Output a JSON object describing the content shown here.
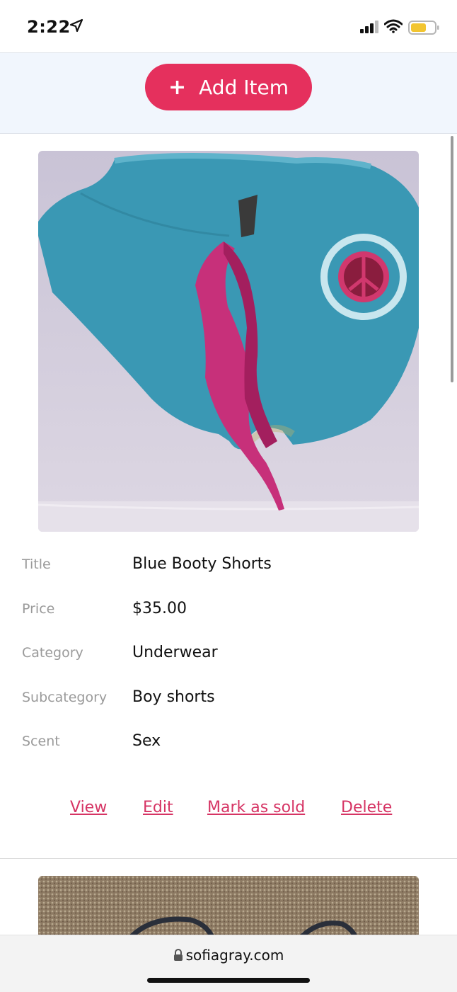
{
  "status": {
    "time": "2:22"
  },
  "toolbar": {
    "add_label": "Add Item"
  },
  "item": {
    "fields": [
      {
        "label": "Title",
        "value": "Blue Booty Shorts"
      },
      {
        "label": "Price",
        "value": "$35.00"
      },
      {
        "label": "Category",
        "value": "Underwear"
      },
      {
        "label": "Subcategory",
        "value": "Boy shorts"
      },
      {
        "label": "Scent",
        "value": "Sex"
      }
    ],
    "actions": {
      "view": "View",
      "edit": "Edit",
      "mark_sold": "Mark as sold",
      "delete": "Delete"
    }
  },
  "browser": {
    "url": "sofiagray.com"
  },
  "colors": {
    "accent": "#e5305d",
    "link": "#d63464",
    "topbar_bg": "#f1f6fd",
    "shorts": "#3a98b4"
  },
  "icons": [
    "location-arrow-icon",
    "signal-icon",
    "wifi-icon",
    "battery-icon",
    "plus-icon",
    "lock-icon"
  ]
}
